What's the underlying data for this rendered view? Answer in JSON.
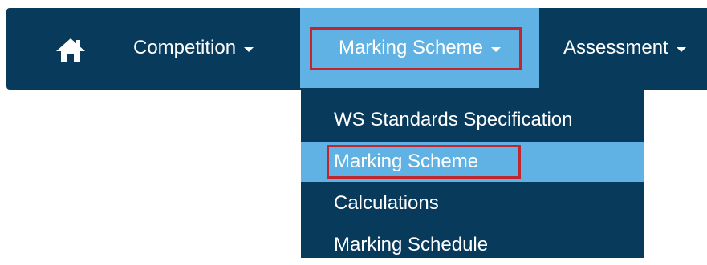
{
  "nav": {
    "home_icon": "home-icon",
    "items": [
      {
        "label": "Competition"
      },
      {
        "label": "Marking Scheme"
      },
      {
        "label": "Assessment"
      }
    ]
  },
  "dropdown": {
    "items": [
      {
        "label": "WS Standards Specification"
      },
      {
        "label": "Marking Scheme"
      },
      {
        "label": "Calculations"
      },
      {
        "label": "Marking Schedule"
      }
    ]
  },
  "colors": {
    "nav_bg": "#083a5b",
    "active_bg": "#5fb2e3",
    "highlight_border": "#c0272d",
    "text": "#ffffff"
  }
}
